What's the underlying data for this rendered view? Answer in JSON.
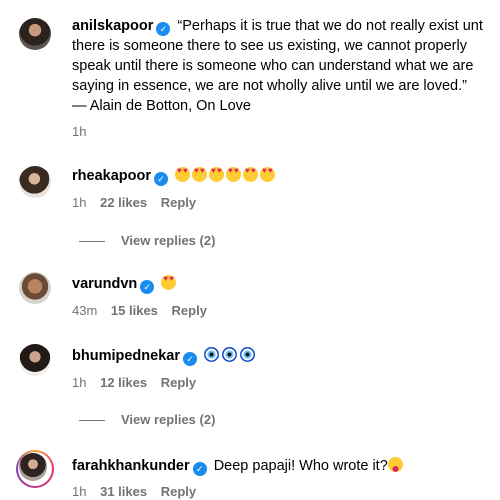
{
  "comments": [
    {
      "username": "anilskapoor",
      "verified": true,
      "text_lines": [
        "“Perhaps it is true that we do not really exist unt",
        "there is someone there to see us existing, we cannot properly",
        "speak until there is someone who can understand what we are",
        "saying in essence, we are not wholly alive until we are loved.”",
        "— Alain de Botton, On Love"
      ],
      "time": "1h"
    },
    {
      "username": "rheakapoor",
      "verified": true,
      "emojis": [
        "heart-eyes-emoji",
        "heart-eyes-emoji",
        "heart-eyes-emoji",
        "heart-eyes-emoji",
        "heart-eyes-emoji",
        "heart-eyes-emoji"
      ],
      "time": "1h",
      "likes": "22 likes",
      "reply": "Reply",
      "view_replies": "View replies (2)"
    },
    {
      "username": "varundvn",
      "verified": true,
      "emojis": [
        "heart-eyes-emoji"
      ],
      "time": "43m",
      "likes": "15 likes",
      "reply": "Reply"
    },
    {
      "username": "bhumipednekar",
      "verified": true,
      "emojis": [
        "nazar-amulet-emoji",
        "nazar-amulet-emoji",
        "nazar-amulet-emoji"
      ],
      "time": "1h",
      "likes": "12 likes",
      "reply": "Reply",
      "view_replies": "View replies (2)"
    },
    {
      "username": "farahkhankunder",
      "verified": true,
      "text": "Deep papaji! Who wrote it?",
      "emojis": [
        "winking-tongue-emoji"
      ],
      "time": "1h",
      "likes": "31 likes",
      "reply": "Reply"
    }
  ],
  "colors": {
    "verified_badge": "#1a8cf0",
    "meta_text": "#737373",
    "story_ring": [
      "#f9a43a",
      "#e1306c",
      "#833ab4"
    ]
  }
}
